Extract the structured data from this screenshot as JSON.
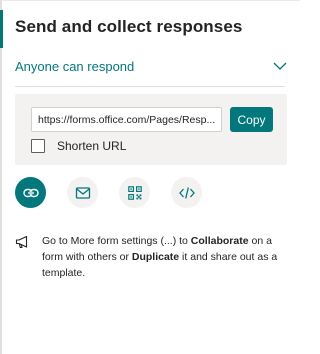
{
  "panel": {
    "title": "Send and collect responses"
  },
  "audience": {
    "selected": "Anyone can respond"
  },
  "link": {
    "url": "https://forms.office.com/Pages/Resp...",
    "copy_label": "Copy",
    "shorten_label": "Shorten URL",
    "shorten_checked": false
  },
  "share_methods": [
    {
      "name": "link",
      "icon": "link-icon",
      "active": true
    },
    {
      "name": "email",
      "icon": "mail-icon",
      "active": false
    },
    {
      "name": "qr-code",
      "icon": "qr-code-icon",
      "active": false
    },
    {
      "name": "embed",
      "icon": "embed-code-icon",
      "active": false
    }
  ],
  "tip": {
    "icon": "megaphone-icon",
    "text_1": "Go to More form settings (...) to ",
    "bold_1": "Collaborate",
    "text_2": " on a form with others or ",
    "bold_2": "Duplicate",
    "text_3": " it and share out as a template."
  },
  "colors": {
    "accent": "#03787c",
    "panel_bg": "#f3f2f1",
    "text": "#252423"
  }
}
